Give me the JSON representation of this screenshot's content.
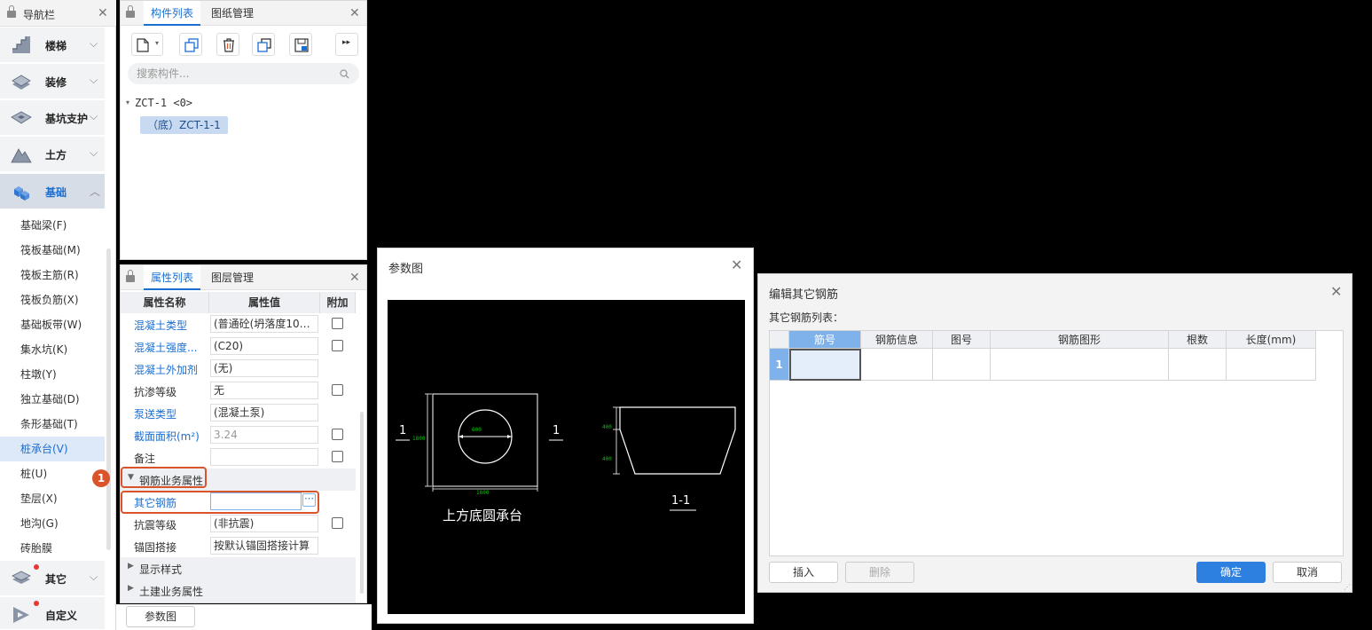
{
  "nav": {
    "title": "导航栏",
    "groups": [
      {
        "label": "楼梯",
        "icon": "stairs-icon"
      },
      {
        "label": "装修",
        "icon": "decoration-icon"
      },
      {
        "label": "基坑支护",
        "icon": "pit-support-icon"
      },
      {
        "label": "土方",
        "icon": "earthwork-icon"
      },
      {
        "label": "基础",
        "icon": "foundation-icon"
      },
      {
        "label": "其它",
        "icon": "other-icon"
      },
      {
        "label": "自定义",
        "icon": "custom-icon"
      }
    ],
    "items": [
      "基础梁(F)",
      "筏板基础(M)",
      "筏板主筋(R)",
      "筏板负筋(X)",
      "基础板带(W)",
      "集水坑(K)",
      "柱墩(Y)",
      "独立基础(D)",
      "条形基础(T)",
      "桩承台(V)",
      "桩(U)",
      "垫层(X)",
      "地沟(G)",
      "砖胎膜"
    ]
  },
  "component_panel": {
    "tabs": [
      "构件列表",
      "图纸管理"
    ],
    "search_placeholder": "搜索构件...",
    "tree_root": "ZCT-1 <0>",
    "tree_child": "（底）ZCT-1-1"
  },
  "property_panel": {
    "tabs": [
      "属性列表",
      "图层管理"
    ],
    "headers": [
      "属性名称",
      "属性值",
      "附加"
    ],
    "rows": [
      {
        "name": "混凝土类型",
        "value": "(普通砼(坍落度10～..."
      },
      {
        "name": "混凝土强度...",
        "value": "(C20)"
      },
      {
        "name": "混凝土外加剂",
        "value": "(无)"
      },
      {
        "name": "抗渗等级",
        "value": "无"
      },
      {
        "name": "泵送类型",
        "value": "(混凝土泵)"
      },
      {
        "name": "截面面积(m²)",
        "value": "3.24"
      },
      {
        "name": "备注",
        "value": ""
      }
    ],
    "section_rebar": "钢筋业务属性",
    "rebar_rows": [
      {
        "name": "其它钢筋",
        "value": ""
      },
      {
        "name": "抗震等级",
        "value": "(非抗震)"
      },
      {
        "name": "锚固搭接",
        "value": "按默认锚固搭接计算"
      }
    ],
    "section_display": "显示样式",
    "section_civil": "土建业务属性",
    "param_button": "参数图",
    "badge": "1"
  },
  "param_dialog": {
    "title": "参数图",
    "caption": "上方底圆承台",
    "section_label": "1",
    "section_label_right": "1",
    "section_view_label": "1-1",
    "dim_diameter": "600",
    "dim_side": "1800",
    "dim_bottom": "1800",
    "dim_top_height": "400",
    "dim_bottom_height": "400"
  },
  "rebar_dialog": {
    "title": "编辑其它钢筋",
    "list_label": "其它钢筋列表：",
    "columns": [
      "筋号",
      "钢筋信息",
      "图号",
      "钢筋图形",
      "根数",
      "长度(mm)"
    ],
    "row_number": "1",
    "insert_button": "插入",
    "delete_button": "删除",
    "confirm_button": "确定",
    "cancel_button": "取消"
  },
  "colors": {
    "accent": "#1b6fd1",
    "annotation": "#d9542a",
    "cad_background": "#000000",
    "cad_line": "#ffffff",
    "cad_dimension": "#00c800"
  }
}
